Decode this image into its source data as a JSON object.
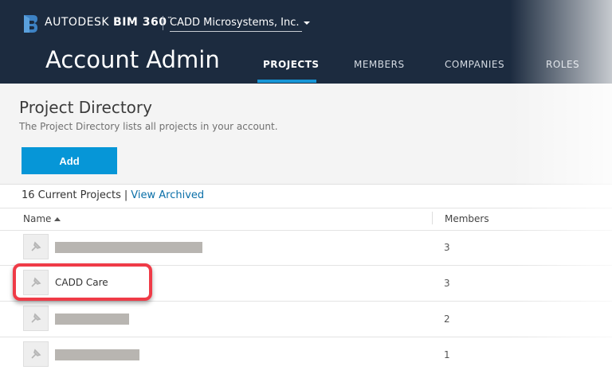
{
  "header": {
    "brand_regular": "AUTODESK",
    "brand_bold": "BIM 360",
    "brand_tm": "™",
    "company": "CADD Microsystems, Inc.",
    "app_title": "Account Admin",
    "tabs": [
      {
        "label": "PROJECTS",
        "active": true
      },
      {
        "label": "MEMBERS",
        "active": false
      },
      {
        "label": "COMPANIES",
        "active": false
      },
      {
        "label": "ROLES",
        "active": false
      }
    ],
    "colors": {
      "background": "#1c2b3f",
      "accent": "#1696d6"
    }
  },
  "page": {
    "title": "Project Directory",
    "description": "The Project Directory lists all projects in your account.",
    "add_label": "Add",
    "count_text": "16 Current Projects",
    "separator": "|",
    "view_archived": "View Archived"
  },
  "table": {
    "columns": {
      "name": "Name",
      "members": "Members"
    },
    "sort": "ascending",
    "rows": [
      {
        "name": "",
        "redacted": true,
        "members": "3"
      },
      {
        "name": "CADD Care",
        "redacted": false,
        "members": "3",
        "highlighted": true
      },
      {
        "name": "",
        "redacted": true,
        "members": "2"
      },
      {
        "name": "",
        "redacted": true,
        "members": "1"
      }
    ]
  },
  "icons": [
    "autodesk-b-logo-icon",
    "chevron-down-icon",
    "sort-ascending-icon",
    "project-thumbnail-icon"
  ],
  "colors": {
    "add_button": "#0696d7",
    "link": "#0a6fa8",
    "callout": "#ef3b47",
    "redaction": "#b8b5b1"
  }
}
